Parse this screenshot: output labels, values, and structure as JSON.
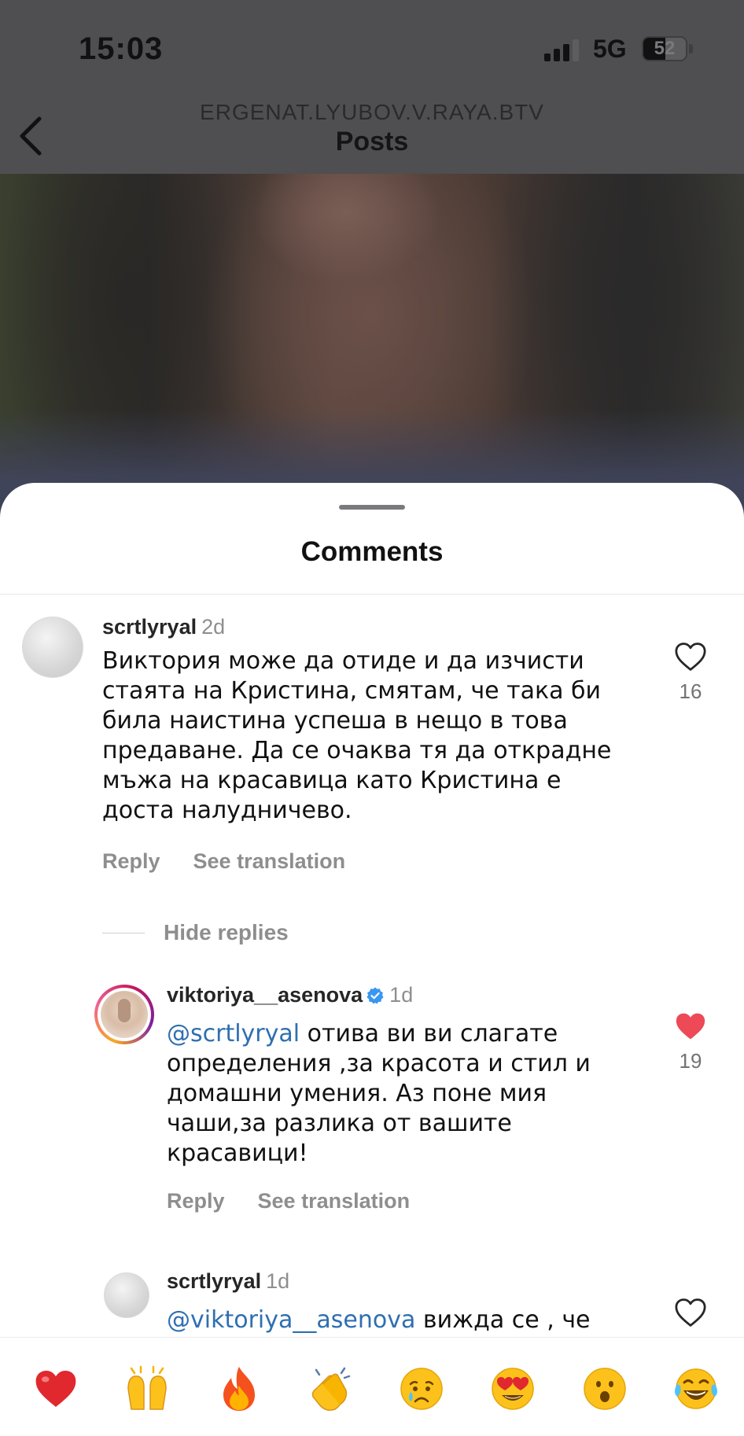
{
  "status_bar": {
    "time": "15:03",
    "network": "5G",
    "battery": "52",
    "battery_level": 0.52
  },
  "header": {
    "account": "ERGENAT.LYUBOV.V.RAYA.BTV",
    "title": "Posts",
    "back_icon": "chevron-left-icon"
  },
  "sheet": {
    "title": "Comments"
  },
  "comments": [
    {
      "user": "scrtlyryal",
      "age": "2d",
      "text": "Виктория може да отиде и да изчисти стаята на Кристина, смятам, че така би била наистина успеша в нещо в това предаване. Да се очаква тя да открадне мъжа на красавица като Кристина е доста налудничево.",
      "reply_label": "Reply",
      "translation_label": "See translation",
      "likes": "16",
      "liked": false
    }
  ],
  "hide_replies_label": "Hide replies",
  "replies": [
    {
      "user": "viktoriya__asenova",
      "verified": true,
      "age": "1d",
      "mention": "@scrtlyryal",
      "text": " отива ви ви слагате определения ,за красота и стил и домашни умения. Аз поне мия чаши,за разлика от вашите красавици!",
      "reply_label": "Reply",
      "translation_label": "See translation",
      "likes": "19",
      "liked": true,
      "like_color": "#ed4956"
    },
    {
      "user": "scrtlyryal",
      "age": "1d",
      "mention": "@viktoriya__asenova",
      "text": " вижда се , че"
    }
  ],
  "reactions": [
    {
      "name": "red-heart",
      "glyph": "❤️"
    },
    {
      "name": "raising-hands",
      "glyph": "🙌"
    },
    {
      "name": "fire",
      "glyph": "🔥"
    },
    {
      "name": "clapping-hands",
      "glyph": "👏"
    },
    {
      "name": "crying-face",
      "glyph": "😢"
    },
    {
      "name": "heart-eyes",
      "glyph": "😍"
    },
    {
      "name": "surprised-face",
      "glyph": "😮"
    },
    {
      "name": "tears-of-joy",
      "glyph": "😂"
    }
  ]
}
